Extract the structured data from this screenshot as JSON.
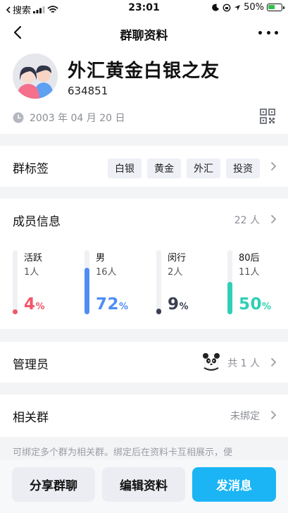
{
  "status_bar": {
    "carrier": "搜索",
    "time": "23:01",
    "battery_percent": "50%",
    "battery_level": 0.5
  },
  "nav": {
    "title": "群聊资料"
  },
  "profile": {
    "group_name": "外汇黄金白银之友",
    "group_id": "634851",
    "created_date": "2003 年 04 月 20 日"
  },
  "tags": {
    "label": "群标签",
    "items": [
      "白银",
      "黄金",
      "外汇",
      "投资"
    ]
  },
  "members": {
    "label": "成员信息",
    "count": "22 人",
    "stats": [
      {
        "label": "活跃",
        "count": "1人",
        "value": "4",
        "unit": "%",
        "fraction": 0.04,
        "color": "#f0576a"
      },
      {
        "label": "男",
        "count": "16人",
        "value": "72",
        "unit": "%",
        "fraction": 0.72,
        "color": "#4e8df5"
      },
      {
        "label": "闵行",
        "count": "2人",
        "value": "9",
        "unit": "%",
        "fraction": 0.09,
        "color": "#3a3f52"
      },
      {
        "label": "80后",
        "count": "11人",
        "value": "50",
        "unit": "%",
        "fraction": 0.5,
        "color": "#2fcfb5"
      }
    ]
  },
  "admin": {
    "label": "管理员",
    "count": "共 1 人"
  },
  "related": {
    "label": "相关群",
    "status": "未绑定",
    "description": "可绑定多个群为相关群。绑定后在资料卡互相展示，便"
  },
  "actions": {
    "share": "分享群聊",
    "edit": "编辑资料",
    "send": "发消息"
  },
  "colors": {
    "accent": "#1bb5f5",
    "divider": "#f3f4f6"
  }
}
